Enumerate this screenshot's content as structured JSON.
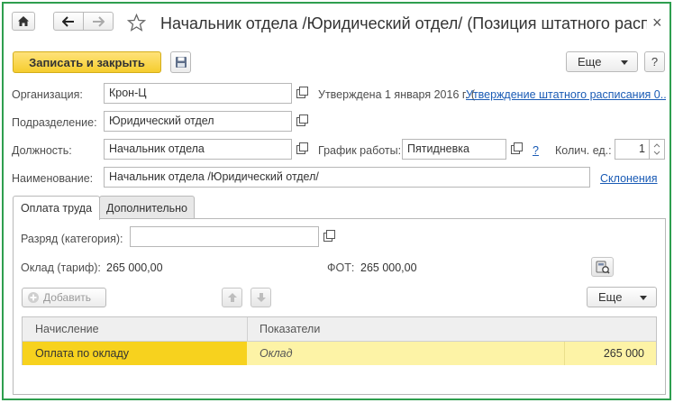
{
  "window": {
    "title": "Начальник отдела /Юридический отдел/ (Позиция штатного распис...",
    "close_glyph": "×"
  },
  "toolbar": {
    "save_close_label": "Записать и закрыть",
    "more_label": "Еще",
    "help_label": "?"
  },
  "form": {
    "organization_label": "Организация:",
    "organization_value": "Крон-Ц",
    "approved_text": "Утверждена 1 января 2016 г. (",
    "approved_link": "Утверждение штатного расписания 0...",
    "department_label": "Подразделение:",
    "department_value": "Юридический отдел",
    "position_label": "Должность:",
    "position_value": "Начальник отдела",
    "schedule_label": "График работы:",
    "schedule_value": "Пятидневка",
    "schedule_help": "?",
    "qty_label": "Колич. ед.:",
    "qty_value": "1",
    "name_label": "Наименование:",
    "name_value": "Начальник отдела /Юридический отдел/",
    "declension_link": "Склонения"
  },
  "tabs": [
    {
      "label": "Оплата труда",
      "active": true
    },
    {
      "label": "Дополнительно",
      "active": false
    }
  ],
  "pay_tab": {
    "grade_label": "Разряд (категория):",
    "grade_value": "",
    "salary_label": "Оклад (тариф):",
    "salary_value": "265 000,00",
    "fot_label": "ФОТ:",
    "fot_value": "265 000,00",
    "add_label": "Добавить",
    "more_label": "Еще",
    "table": {
      "columns": [
        "Начисление",
        "Показатели"
      ],
      "rows": [
        {
          "accrual": "Оплата по окладу",
          "indicator": "Оклад",
          "amount": "265 000"
        }
      ]
    }
  },
  "colors": {
    "frame_border": "#2e9e4f",
    "primary_button": "#f5cd2e",
    "selected_row": "#fdf3a6",
    "selected_cell": "#f7d21e",
    "link": "#1a5bb5"
  },
  "icons": [
    "home-icon",
    "back-arrow-icon",
    "forward-arrow-icon",
    "star-icon",
    "close-icon",
    "save-icon",
    "open-icon",
    "calculator-icon",
    "move-up-icon",
    "move-down-icon",
    "add-icon"
  ]
}
